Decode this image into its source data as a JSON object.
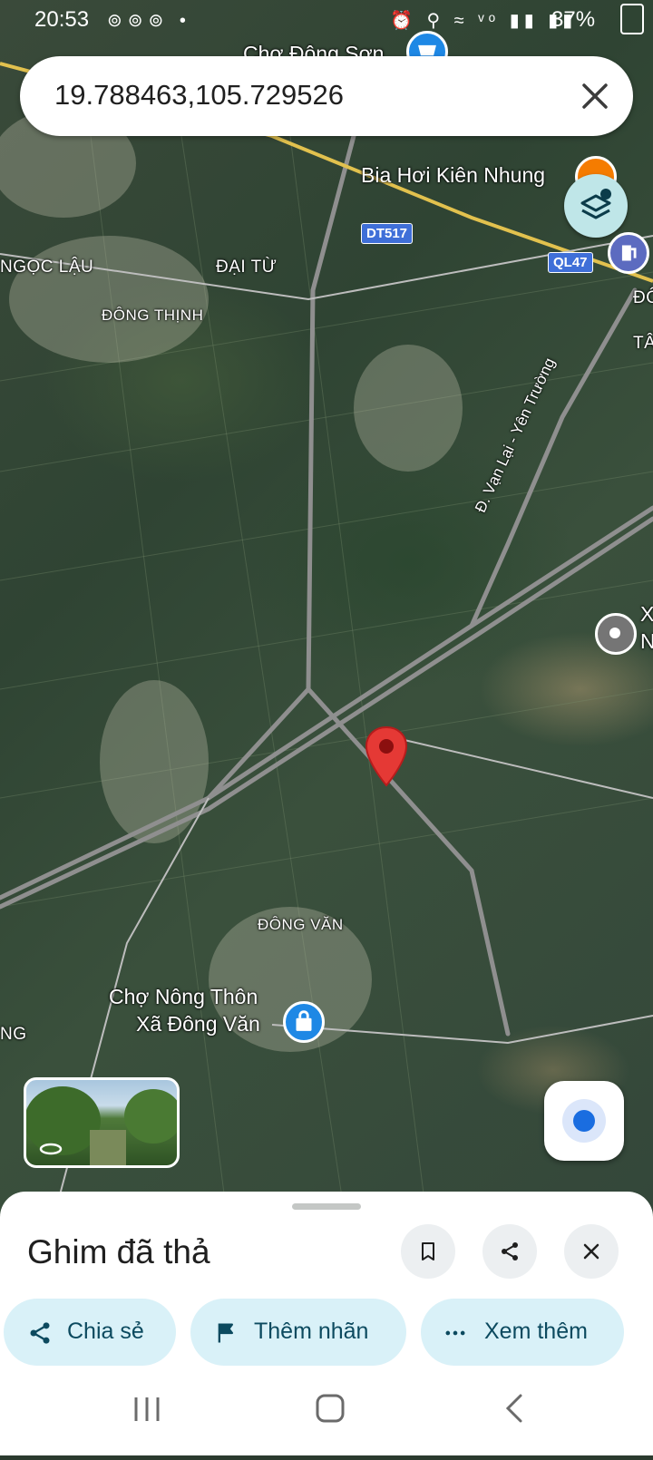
{
  "status_bar": {
    "time": "20:53",
    "battery": "37%",
    "left_icons": "⊚⊚⊚ •",
    "right_icons": "⏰ ⚲ ≈ ᵛᵒ ▮▮ ▮▮"
  },
  "search": {
    "value": "19.788463,105.729526"
  },
  "map": {
    "labels": {
      "cho_dong_son": "Chợ Đông Sơn",
      "bia_hoi": "Bia Hơi Kiên Nhung",
      "ngoc_lau": "NGỌC LẬU",
      "dai_tu": "ĐẠI TỪ",
      "dong_thinh": "ĐÔNG THỊNH",
      "dong_van": "ĐÔNG VĂN",
      "cho_nong_thon_1": "Chợ Nông Thôn",
      "cho_nong_thon_2": "Xã Đông Văn",
      "road_van_lai": "Đ. Vạn Lại - Yên Trường",
      "edge_ng": "NG",
      "edge_do": "ĐÔ",
      "edge_ta": "TÂ",
      "edge_x": "X",
      "edge_n": "N"
    },
    "shields": {
      "dt517": "DT517",
      "ql47": "QL47"
    },
    "colors": {
      "pin": "#e53935",
      "shop_marker": "#1e88e5",
      "restaurant_marker": "#f57c00",
      "fuel_marker": "#5c6bc0",
      "place_marker": "#757575"
    }
  },
  "sheet": {
    "title": "Ghim đã thả",
    "actions": {
      "share": "Chia sẻ",
      "label": "Thêm nhãn",
      "more": "Xem thêm"
    }
  },
  "icons": {
    "close": "close-icon",
    "layers": "layers-icon",
    "bookmark": "bookmark-icon",
    "share": "share-icon",
    "flag": "flag-icon",
    "more": "more-horiz-icon",
    "locate": "my-location-icon"
  }
}
